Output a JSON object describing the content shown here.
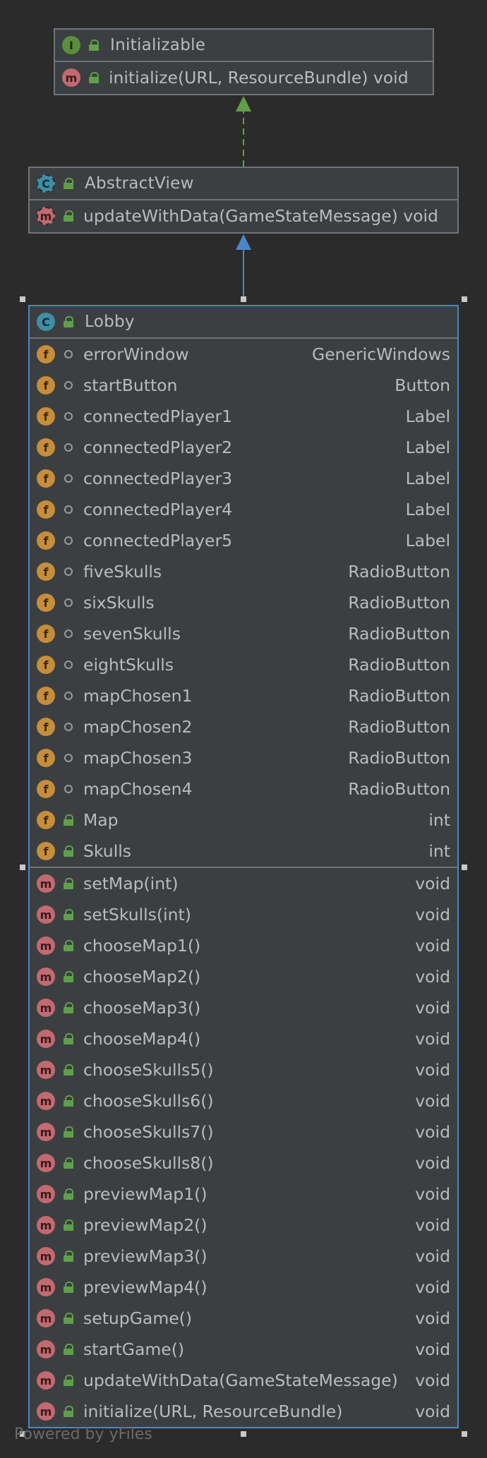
{
  "interface_initializable": {
    "name": "Initializable",
    "badge": "I",
    "methods": [
      {
        "badge": "m",
        "name": "initialize(URL, ResourceBundle) void",
        "type": ""
      }
    ]
  },
  "class_abstractview": {
    "name": "AbstractView",
    "badge": "C",
    "methods": [
      {
        "badge": "m",
        "name": "updateWithData(GameStateMessage) void",
        "type": ""
      }
    ]
  },
  "class_lobby": {
    "name": "Lobby",
    "badge": "C",
    "fields": [
      {
        "badge": "f",
        "vis": "package",
        "name": "errorWindow",
        "type": "GenericWindows"
      },
      {
        "badge": "f",
        "vis": "package",
        "name": "startButton",
        "type": "Button"
      },
      {
        "badge": "f",
        "vis": "package",
        "name": "connectedPlayer1",
        "type": "Label"
      },
      {
        "badge": "f",
        "vis": "package",
        "name": "connectedPlayer2",
        "type": "Label"
      },
      {
        "badge": "f",
        "vis": "package",
        "name": "connectedPlayer3",
        "type": "Label"
      },
      {
        "badge": "f",
        "vis": "package",
        "name": "connectedPlayer4",
        "type": "Label"
      },
      {
        "badge": "f",
        "vis": "package",
        "name": "connectedPlayer5",
        "type": "Label"
      },
      {
        "badge": "f",
        "vis": "package",
        "name": "fiveSkulls",
        "type": "RadioButton"
      },
      {
        "badge": "f",
        "vis": "package",
        "name": "sixSkulls",
        "type": "RadioButton"
      },
      {
        "badge": "f",
        "vis": "package",
        "name": "sevenSkulls",
        "type": "RadioButton"
      },
      {
        "badge": "f",
        "vis": "package",
        "name": "eightSkulls",
        "type": "RadioButton"
      },
      {
        "badge": "f",
        "vis": "package",
        "name": "mapChosen1",
        "type": "RadioButton"
      },
      {
        "badge": "f",
        "vis": "package",
        "name": "mapChosen2",
        "type": "RadioButton"
      },
      {
        "badge": "f",
        "vis": "package",
        "name": "mapChosen3",
        "type": "RadioButton"
      },
      {
        "badge": "f",
        "vis": "package",
        "name": "mapChosen4",
        "type": "RadioButton"
      },
      {
        "badge": "f",
        "vis": "public",
        "name": "Map",
        "type": "int"
      },
      {
        "badge": "f",
        "vis": "public",
        "name": "Skulls",
        "type": "int"
      }
    ],
    "methods": [
      {
        "badge": "m",
        "vis": "public",
        "name": "setMap(int)",
        "type": "void"
      },
      {
        "badge": "m",
        "vis": "public",
        "name": "setSkulls(int)",
        "type": "void"
      },
      {
        "badge": "m",
        "vis": "public",
        "name": "chooseMap1()",
        "type": "void"
      },
      {
        "badge": "m",
        "vis": "public",
        "name": "chooseMap2()",
        "type": "void"
      },
      {
        "badge": "m",
        "vis": "public",
        "name": "chooseMap3()",
        "type": "void"
      },
      {
        "badge": "m",
        "vis": "public",
        "name": "chooseMap4()",
        "type": "void"
      },
      {
        "badge": "m",
        "vis": "public",
        "name": "chooseSkulls5()",
        "type": "void"
      },
      {
        "badge": "m",
        "vis": "public",
        "name": "chooseSkulls6()",
        "type": "void"
      },
      {
        "badge": "m",
        "vis": "public",
        "name": "chooseSkulls7()",
        "type": "void"
      },
      {
        "badge": "m",
        "vis": "public",
        "name": "chooseSkulls8()",
        "type": "void"
      },
      {
        "badge": "m",
        "vis": "public",
        "name": "previewMap1()",
        "type": "void"
      },
      {
        "badge": "m",
        "vis": "public",
        "name": "previewMap2()",
        "type": "void"
      },
      {
        "badge": "m",
        "vis": "public",
        "name": "previewMap3()",
        "type": "void"
      },
      {
        "badge": "m",
        "vis": "public",
        "name": "previewMap4()",
        "type": "void"
      },
      {
        "badge": "m",
        "vis": "public",
        "name": "setupGame()",
        "type": "void"
      },
      {
        "badge": "m",
        "vis": "public",
        "name": "startGame()",
        "type": "void"
      },
      {
        "badge": "m",
        "vis": "public",
        "name": "updateWithData(GameStateMessage)",
        "type": "void"
      },
      {
        "badge": "m",
        "vis": "public",
        "name": "initialize(URL, ResourceBundle)",
        "type": "void"
      }
    ]
  },
  "footer": {
    "text": "Powered by yFiles"
  },
  "colors": {
    "background": "#2b2b2b",
    "node_fill": "#3c3f41",
    "node_border": "#6f737a",
    "selection": "#4a88c7",
    "realization_arrow": "#5ea04a",
    "inheritance_arrow": "#4a88c7",
    "field_badge": "#c68d3a",
    "method_badge": "#c26a6f",
    "class_badge": "#3f8ea4",
    "interface_badge": "#5a8e3c"
  }
}
